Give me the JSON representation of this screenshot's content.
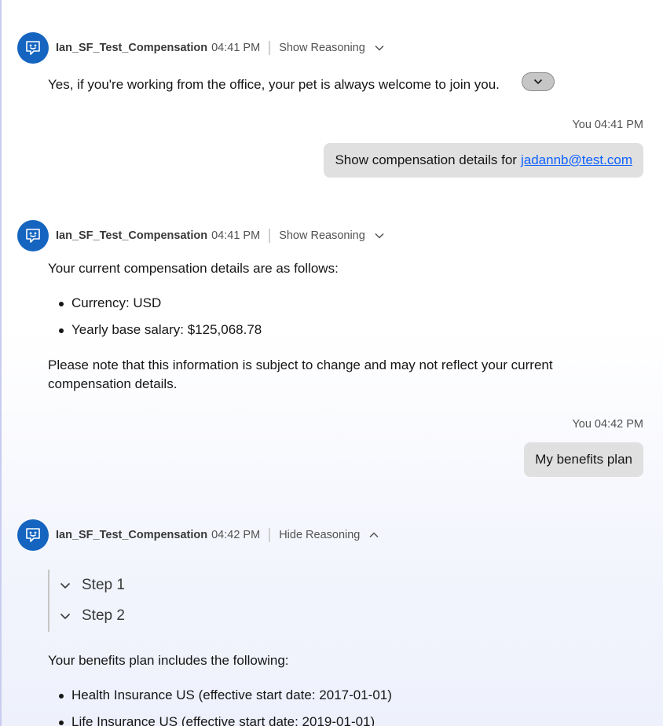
{
  "messages": [
    {
      "bot_name": "Ian_SF_Test_Compensation",
      "time": "04:41 PM",
      "reasoning_label": "Show Reasoning",
      "text": "Yes, if you're working from the office, your pet is always welcome to join you."
    },
    {
      "user_meta": "You 04:41 PM",
      "text": "Show compensation details for",
      "link": "jadannb@test.com"
    },
    {
      "bot_name": "Ian_SF_Test_Compensation",
      "time": "04:41 PM",
      "reasoning_label": "Show Reasoning",
      "intro": "Your current compensation details are as follows:",
      "bullets": [
        "Currency: USD",
        "Yearly base salary: $125,068.78"
      ],
      "note": "Please note that this information is subject to change and may not reflect your current compensation details."
    },
    {
      "user_meta": "You 04:42 PM",
      "text": "My benefits plan"
    },
    {
      "bot_name": "Ian_SF_Test_Compensation",
      "time": "04:42 PM",
      "reasoning_label": "Hide Reasoning",
      "steps": [
        "Step 1",
        "Step 2"
      ],
      "intro": "Your benefits plan includes the following:",
      "bullets": [
        "Health Insurance US (effective start date: 2017-01-01)",
        "Life Insurance US (effective start date: 2019-01-01)"
      ]
    }
  ],
  "icons": {
    "avatar": "chat-bot-icon",
    "expand": "chevron-down-icon",
    "collapse": "chevron-up-icon"
  },
  "colors": {
    "avatar_bg": "#1565c0",
    "link": "#0f62fe",
    "user_bubble": "#e0e0e0"
  }
}
